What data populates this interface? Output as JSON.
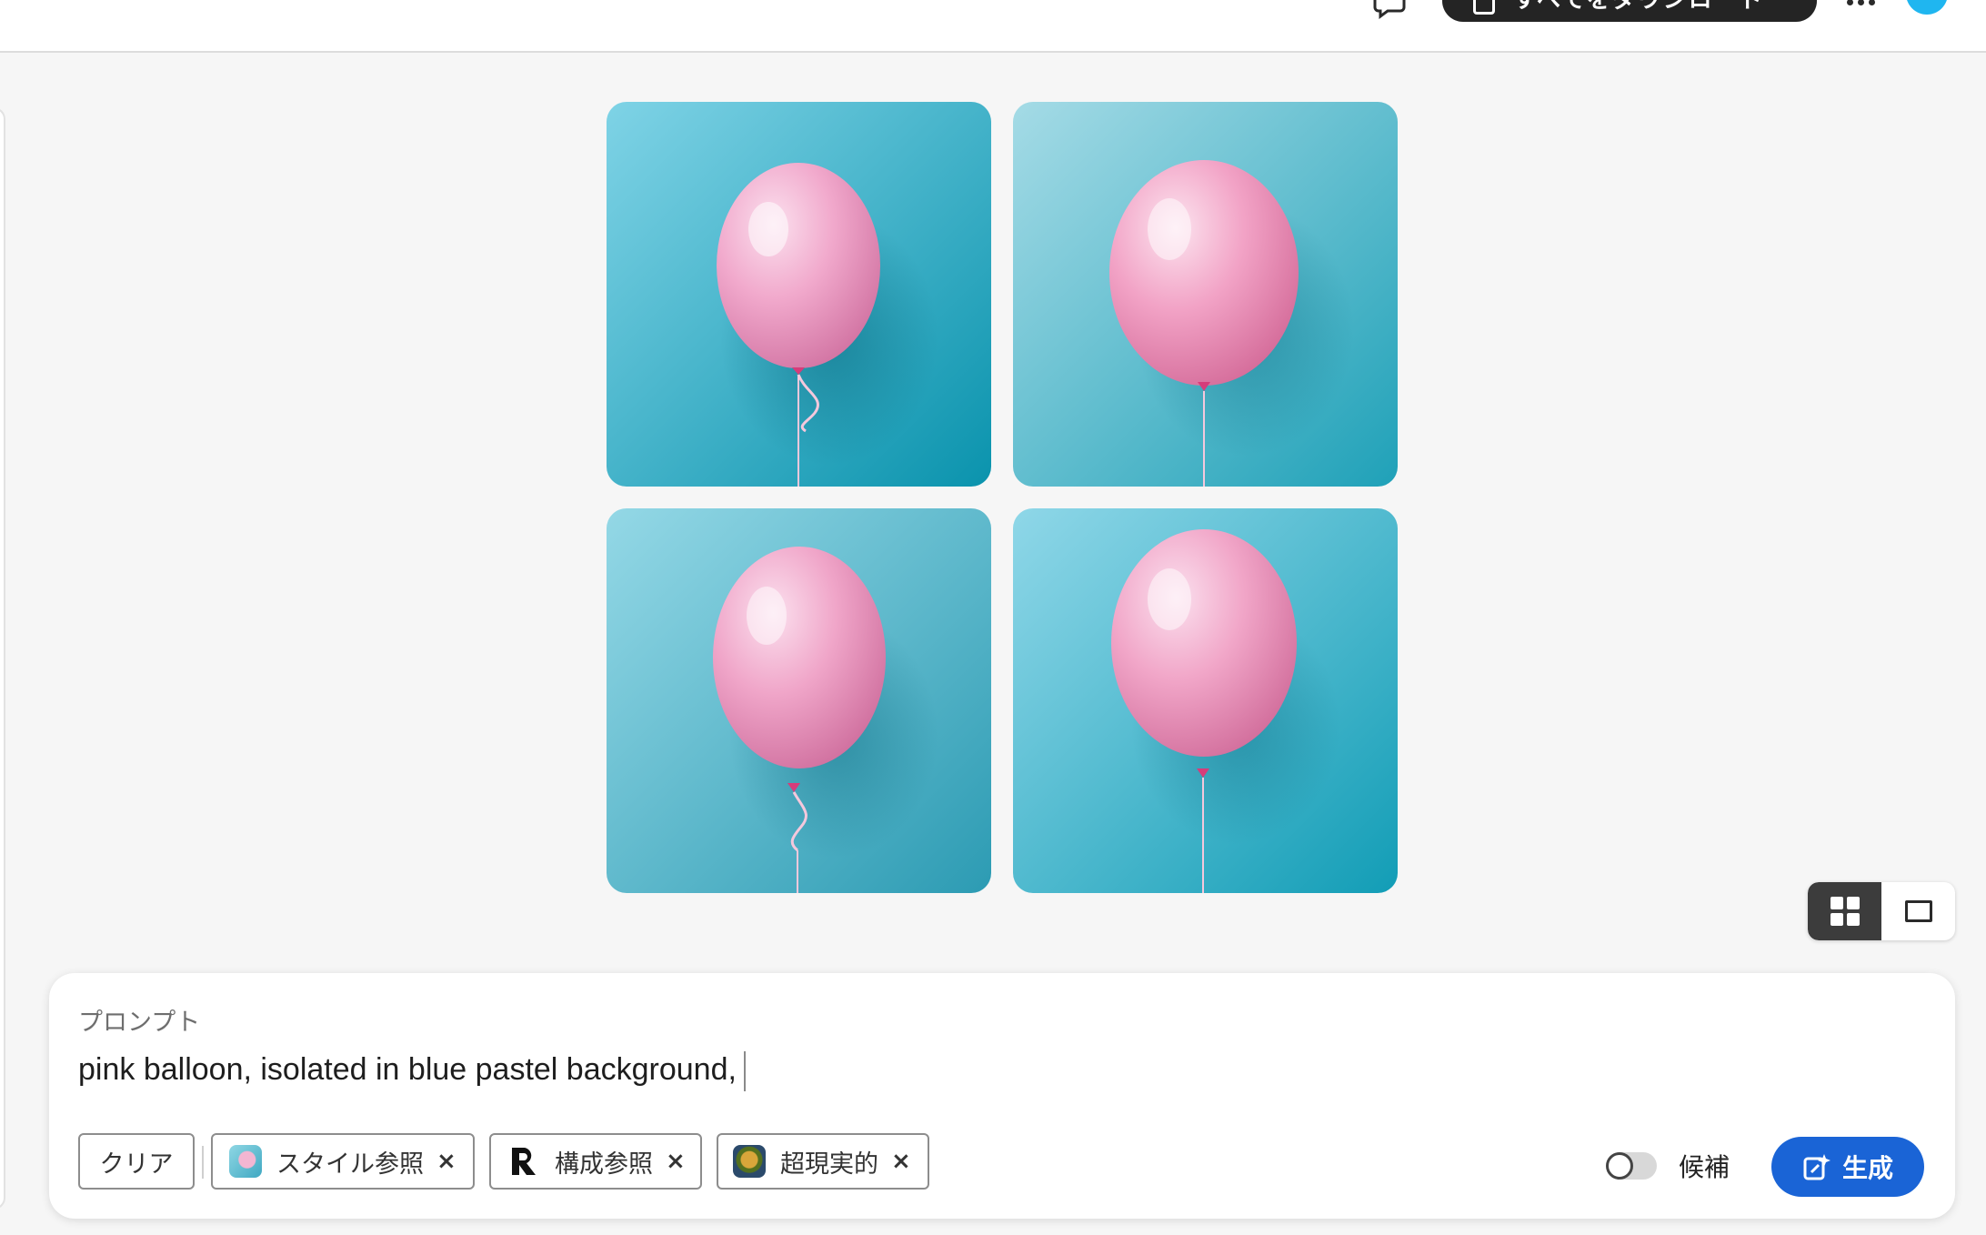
{
  "header": {
    "download_label": "すべてをダウンロード",
    "icons": {
      "chat": "chat-bubble-icon",
      "download": "download-icon",
      "more": "more-dots-icon",
      "avatar": "user-avatar"
    }
  },
  "results": {
    "images": [
      {
        "alt": "pink balloon on blue background 1"
      },
      {
        "alt": "pink balloon on blue background 2"
      },
      {
        "alt": "pink balloon on blue background 3"
      },
      {
        "alt": "pink balloon on blue background 4"
      }
    ],
    "view_modes": [
      "grid-view-icon",
      "single-view-icon"
    ],
    "active_view": "grid"
  },
  "prompt": {
    "label": "プロンプト",
    "text": "pink balloon, isolated in blue pastel background,",
    "clear_label": "クリア",
    "chips": [
      {
        "label": "スタイル参照",
        "icon": "style-reference-thumbnail"
      },
      {
        "label": "構成参照",
        "icon": "composition-reference-thumbnail"
      },
      {
        "label": "超現実的",
        "icon": "hyperreal-effect-thumbnail"
      }
    ],
    "suggestions_label": "候補",
    "suggestions_enabled": false,
    "generate_label": "生成"
  },
  "colors": {
    "accent": "#1a64d6",
    "dark_button": "#242424",
    "avatar": "#1fb6f0"
  }
}
